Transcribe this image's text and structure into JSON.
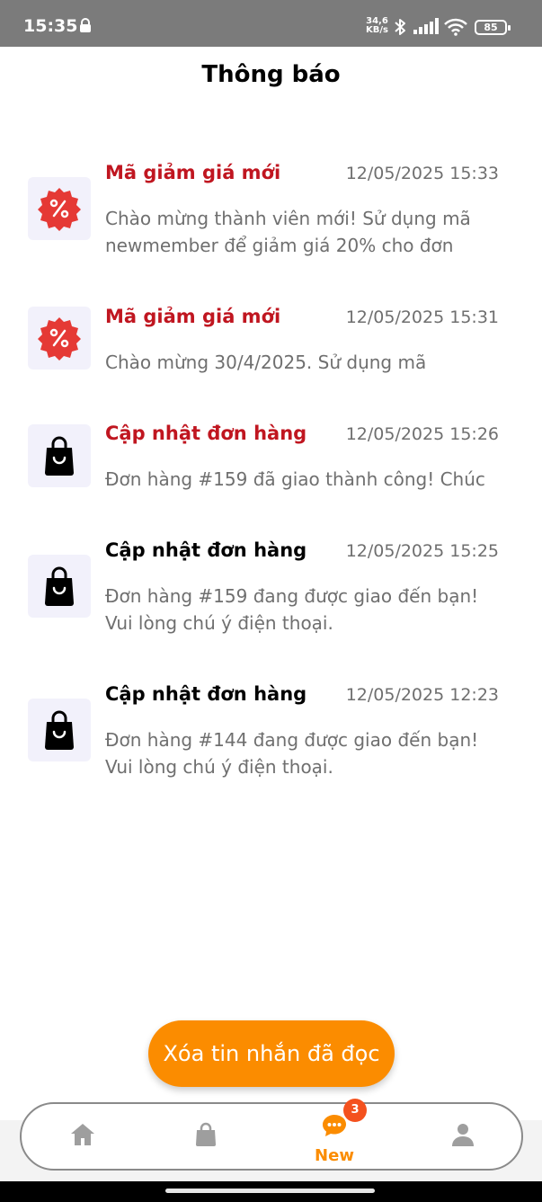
{
  "status_bar": {
    "time": "15:35",
    "net_speed_value": "34,6",
    "net_speed_unit": "KB/s",
    "battery": "85",
    "icons": [
      "lock-icon",
      "bluetooth-icon",
      "signal-icon",
      "wifi-icon",
      "battery-icon"
    ]
  },
  "header": {
    "title": "Thông báo"
  },
  "notifications": [
    {
      "icon": "discount-icon",
      "title": "Mã giảm giá mới",
      "time": "12/05/2025 15:33",
      "body": "Chào mừng thành viên mới! Sử dụng mã newmember để giảm giá 20% cho đơn",
      "unread": true
    },
    {
      "icon": "discount-icon",
      "title": "Mã giảm giá mới",
      "time": "12/05/2025 15:31",
      "body": "Chào mừng 30/4/2025. Sử dụng mã",
      "unread": true
    },
    {
      "icon": "shopping-bag-icon",
      "title": "Cập nhật đơn hàng",
      "time": "12/05/2025 15:26",
      "body": "Đơn hàng #159 đã giao thành công! Chúc",
      "unread": true
    },
    {
      "icon": "shopping-bag-icon",
      "title": "Cập nhật đơn hàng",
      "time": "12/05/2025 15:25",
      "body": "Đơn hàng #159 đang được giao đến bạn! Vui lòng chú ý điện thoại.",
      "unread": false
    },
    {
      "icon": "shopping-bag-icon",
      "title": "Cập nhật đơn hàng",
      "time": "12/05/2025 12:23",
      "body": "Đơn hàng #144 đang được giao đến bạn! Vui lòng chú ý điện thoại.",
      "unread": false
    }
  ],
  "actions": {
    "clear_read": "Xóa tin nhắn đã đọc"
  },
  "bottom_nav": {
    "items": [
      {
        "icon": "home-icon",
        "active": false
      },
      {
        "icon": "shopping-bag-icon",
        "active": false
      },
      {
        "icon": "chat-icon",
        "label": "New",
        "badge": "3",
        "active": true
      },
      {
        "icon": "person-icon",
        "active": false
      }
    ]
  },
  "colors": {
    "accent": "#fb8c00",
    "unread_title": "#c01620",
    "badge": "#f4511e",
    "nav_inactive": "#9e9e9e"
  }
}
